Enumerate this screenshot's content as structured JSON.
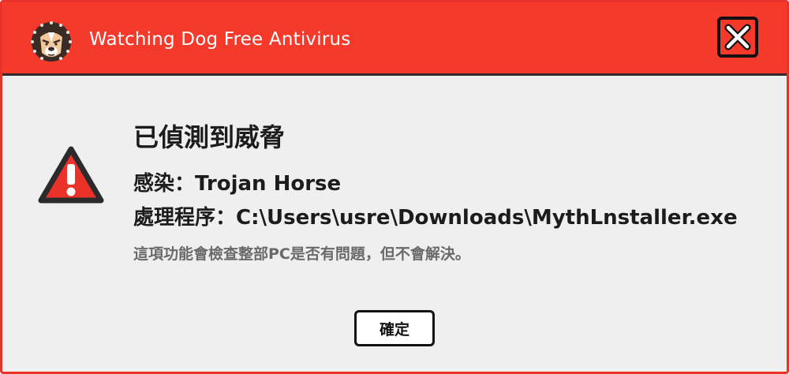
{
  "window": {
    "title": "Watching Dog Free Antivirus",
    "logo_icon": "dog-face-icon",
    "close_icon": "close-icon"
  },
  "alert": {
    "icon": "warning-triangle-icon",
    "heading": "已偵測到威脅",
    "infection_label": "感染：",
    "infection_value": "Trojan Horse",
    "path_label": "處理程序：",
    "path_value": "C:\\Users\\usre\\Downloads\\MythLnstaller.exe",
    "note": "這項功能會檢查整部PC是否有問題，但不會解決。"
  },
  "buttons": {
    "ok_label": "確定"
  },
  "colors": {
    "titlebar": "#f5392b",
    "border": "#e8322a",
    "body_bg": "#efefef",
    "warning_red": "#e8322a"
  }
}
